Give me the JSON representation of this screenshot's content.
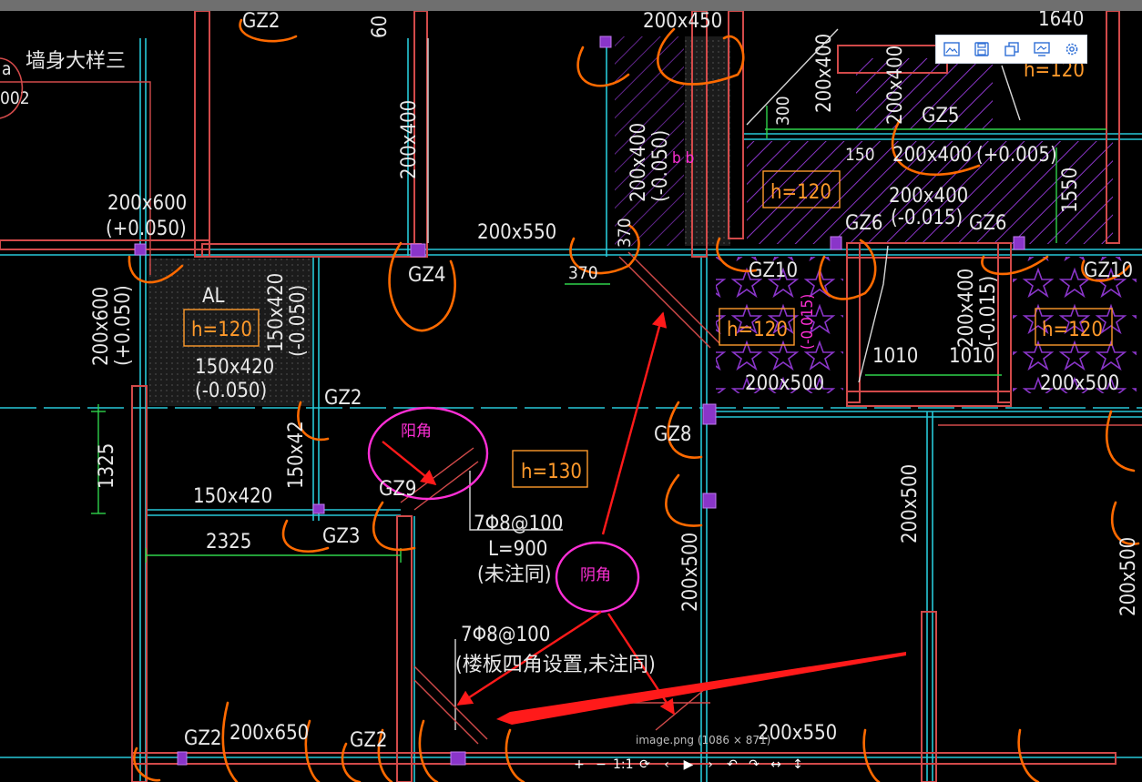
{
  "title": "墙身大样三",
  "left_edge_labels": [
    "a",
    "002"
  ],
  "beam_labels": {
    "b200x600_top": "200x600",
    "b200x600_top_elev": "(+0.050)",
    "b200x600_vert": "200x600",
    "b200x600_vert_elev": "(+0.050)",
    "b150x420_a": "150x420",
    "b150x420_a_elev": "(-0.050)",
    "b150x420_b": "150x420",
    "b150x420_b_elev": "(-0.050)",
    "b150x420_c": "150x420",
    "b150x420_d": "150x42",
    "b200x400_left": "200x400",
    "b200x550_top": "200x550",
    "b200x400_mid": "200x400",
    "b200x400_mid_elev": "(-0.050)",
    "b200x450_top": "200x450",
    "b200x400_right": "200x400",
    "b200x400_right_elev": "(+0.005)",
    "b200x400_c": "200x400",
    "b200x400_c_elev": "(-0.015)",
    "b200x400_vtop": "200x400",
    "b200x400_vright": "200x400",
    "b200x400_vright_elev": "(-0.015)",
    "b200x400_v2": "200x400",
    "b200x400_v2_elev": "(-0.015)",
    "b200x500_a": "200x500",
    "b200x500_b": "200x500",
    "b200x500_v": "200x500",
    "b200x500_v2": "200x500",
    "b200x500_v3": "200x500",
    "b200x650": "200x650",
    "b200x550_bot": "200x550"
  },
  "column_labels": [
    "GZ2",
    "GZ4",
    "GZ2",
    "GZ9",
    "GZ3",
    "GZ8",
    "GZ5",
    "GZ6",
    "GZ6",
    "GZ10",
    "GZ10",
    "GZ2",
    "GZ2"
  ],
  "slab_labels": [
    "h=120",
    "h=130",
    "h=120",
    "h=120",
    "h=120",
    "h=120"
  ],
  "dimension_labels": {
    "d60": "60",
    "d1640": "1640",
    "d300": "300",
    "d150": "150",
    "d1550": "1550",
    "d370_a": "370",
    "d370_b": "370",
    "d1325": "1325",
    "d2325": "2325",
    "d1010_a": "1010",
    "d1010_b": "1010"
  },
  "misc_labels": {
    "al": "AL",
    "bb": "b b",
    "bb2": "b b"
  },
  "rebar_notes": {
    "note1_a": "7Φ8@100",
    "note1_b": "L=900",
    "note1_c": "(未注同)",
    "note2_a": "7Φ8@100",
    "note2_b": "(楼板四角设置,未注同)"
  },
  "annotations": {
    "yangjiao": "阳角",
    "yinjiao": "阴角"
  },
  "image_info": "image.png (1086 × 871)",
  "toolbar": {
    "icons": [
      "image-icon",
      "save-icon",
      "copy-icon",
      "screen-icon",
      "gear-icon"
    ]
  },
  "viewer_controls": [
    "+",
    "−",
    "1:1",
    "⟳",
    "‹",
    "▶",
    "›",
    "↶",
    "↷",
    "↔",
    "↕"
  ],
  "colors": {
    "background": "#000000",
    "wall_red": "#d24a4a",
    "grid_cyan": "#27c8d8",
    "dim_green": "#2fd24a",
    "hatch_purple": "#8a35c9",
    "markup_orange": "#ff6a00",
    "annotation_magenta": "#ff2fd6",
    "arrow_red": "#ff1a1a",
    "slab_text": "#ff9a2b"
  }
}
